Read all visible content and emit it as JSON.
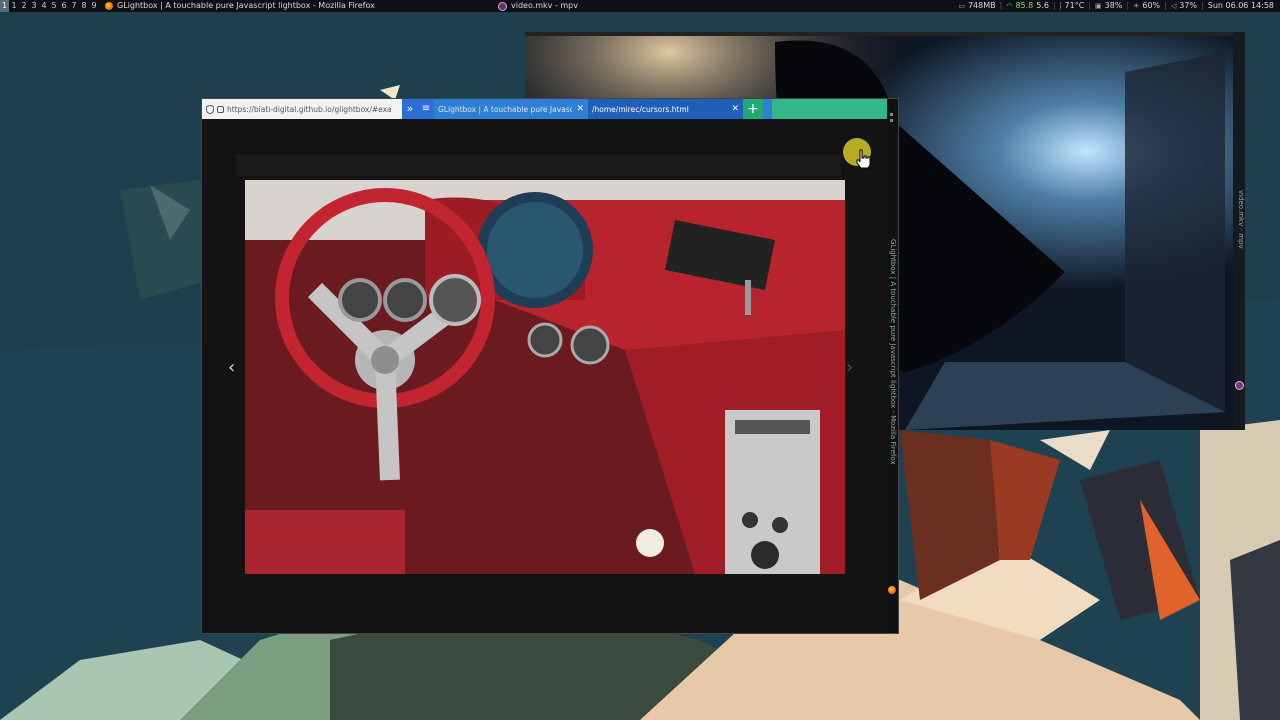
{
  "topbar": {
    "workspaces": [
      "1",
      "2",
      "3",
      "4",
      "5",
      "6",
      "7",
      "8",
      "9"
    ],
    "focused_window_title": "GLightbox | A touchable pure Javascript lightbox - Mozilla Firefox",
    "secondary_window_title": "video.mkv - mpv",
    "status": {
      "memory": "748MB",
      "net_up": "85.8",
      "net_down": "5.6",
      "temp": "71°C",
      "cpu": "38%",
      "brightness": "60%",
      "volume": "37%",
      "datetime": "Sun 06.06 14:58"
    }
  },
  "firefox": {
    "url": "https://biati-digital.github.io/glightbox/#exa",
    "tabs": [
      {
        "label": "GLightbox | A touchable pure Javascript lightbox",
        "active": false
      },
      {
        "label": "/home/mirec/cursors.html",
        "active": true
      }
    ],
    "side_title": "GLightbox | A touchable pure Javascript lightbox - Mozilla Firefox",
    "lightbox": {
      "prev_glyph": "‹",
      "next_glyph": "›"
    }
  },
  "mpv": {
    "side_title": "video.mkv - mpv"
  },
  "icons": [
    "firefox-icon",
    "mpv-icon",
    "lock-icon",
    "shield-icon",
    "overflow-chevrons-icon",
    "menu-icon",
    "close-icon",
    "plus-icon",
    "hand-cursor-icon"
  ],
  "colors": {
    "tab_blue": "#2f7fd6",
    "tab_active": "#1f5fb8",
    "tab_green": "#33b88c",
    "topbar": "#0e1113"
  }
}
